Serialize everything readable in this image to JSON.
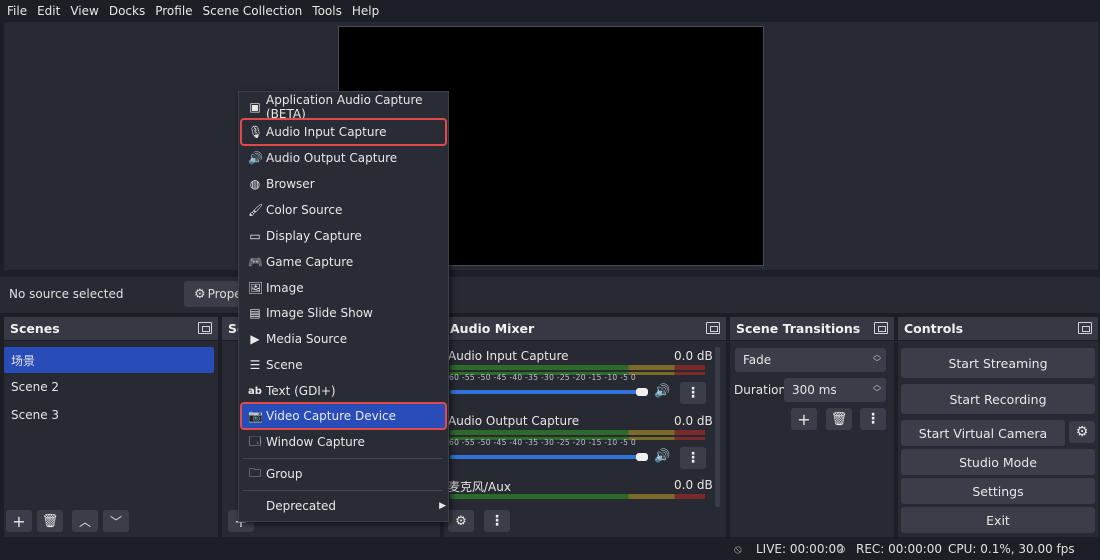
{
  "menubar": [
    "File",
    "Edit",
    "View",
    "Docks",
    "Profile",
    "Scene Collection",
    "Tools",
    "Help"
  ],
  "source_bar": {
    "no_source": "No source selected",
    "properties_label": "Prope"
  },
  "scenes": {
    "title": "Scenes",
    "items": [
      "场景",
      "Scene 2",
      "Scene 3"
    ],
    "selected": "场景"
  },
  "sources": {
    "title": "So"
  },
  "audio_mixer": {
    "title": "Audio Mixer",
    "ticks": "-60 -55 -50 -45 -40 -35 -30 -25 -20 -15 -10  -5  0",
    "channels": [
      {
        "name": "Audio Input Capture",
        "db": "0.0 dB",
        "level": 0.95
      },
      {
        "name": "Audio Output Capture",
        "db": "0.0 dB",
        "level": 0.95
      },
      {
        "name": "麦克风/Aux",
        "db": "0.0 dB",
        "level": 0.0
      }
    ]
  },
  "transitions": {
    "title": "Scene Transitions",
    "selected": "Fade",
    "duration_label": "Duration",
    "duration_value": "300 ms"
  },
  "controls": {
    "title": "Controls",
    "start_streaming": "Start Streaming",
    "start_recording": "Start Recording",
    "start_virtual_camera": "Start Virtual Camera",
    "studio_mode": "Studio Mode",
    "settings": "Settings",
    "exit": "Exit"
  },
  "status": {
    "live": "LIVE: 00:00:00",
    "rec": "REC: 00:00:00",
    "cpu": "CPU: 0.1%, 30.00 fps"
  },
  "context_menu": {
    "items": [
      {
        "label": "Application Audio Capture (BETA)",
        "icon": "app-audio-icon"
      },
      {
        "label": "Audio Input Capture",
        "icon": "microphone-icon",
        "boxed": true
      },
      {
        "label": "Audio Output Capture",
        "icon": "speaker-icon"
      },
      {
        "label": "Browser",
        "icon": "globe-icon"
      },
      {
        "label": "Color Source",
        "icon": "brush-icon"
      },
      {
        "label": "Display Capture",
        "icon": "monitor-icon"
      },
      {
        "label": "Game Capture",
        "icon": "gamepad-icon"
      },
      {
        "label": "Image",
        "icon": "image-icon"
      },
      {
        "label": "Image Slide Show",
        "icon": "slideshow-icon"
      },
      {
        "label": "Media Source",
        "icon": "play-icon"
      },
      {
        "label": "Scene",
        "icon": "list-icon"
      },
      {
        "label": "Text (GDI+)",
        "icon": "text-icon"
      },
      {
        "label": "Video Capture Device",
        "icon": "camera-icon",
        "boxed": true,
        "highlighted": true
      },
      {
        "label": "Window Capture",
        "icon": "window-icon"
      }
    ],
    "group": "Group",
    "deprecated": "Deprecated"
  },
  "accent_color": "#284cb8",
  "annotation_color": "#e04a4a"
}
